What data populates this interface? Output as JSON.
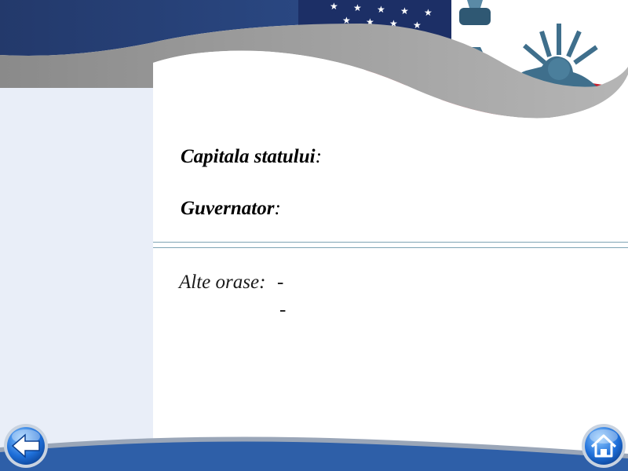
{
  "slide": {
    "fields": {
      "capital_label": "Capitala statului",
      "governor_label": "Guvernator",
      "colon": ":"
    },
    "other_cities": {
      "label": "Alte orase:",
      "items": [
        "-",
        "-"
      ]
    }
  },
  "navigation": {
    "back_icon": "arrow-left-icon",
    "home_icon": "house-icon"
  },
  "colors": {
    "header_navy": "#1f3a6e",
    "header_gray": "#8c8c8c",
    "sidebar": "#e9eef8",
    "footer_blue": "#2e5fa8",
    "button_blue": "#1e6fd9",
    "divider": "#7fa4b4"
  }
}
